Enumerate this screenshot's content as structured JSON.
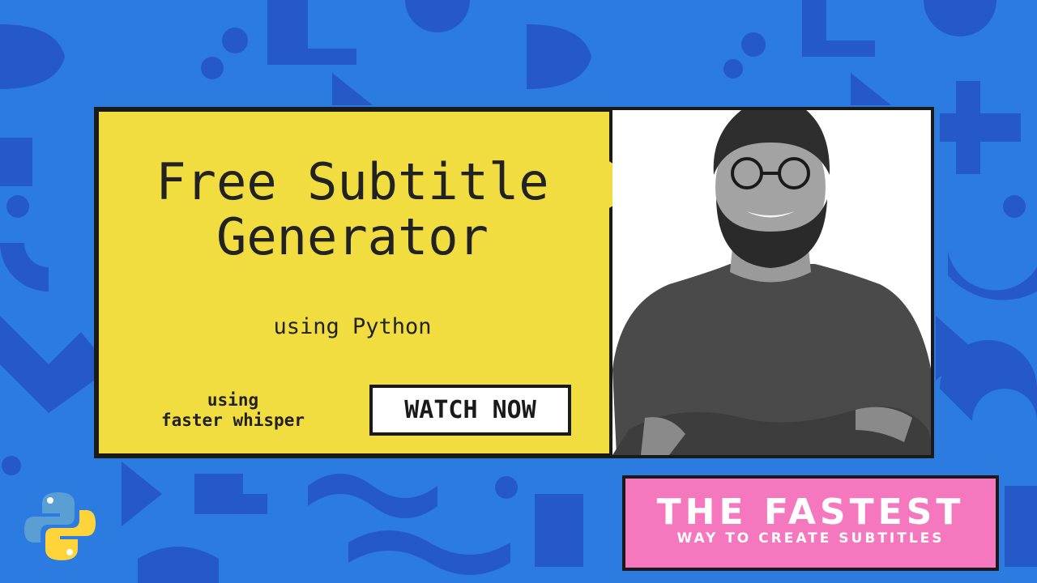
{
  "title_line1": "Free Subtitle",
  "title_line2": "Generator",
  "subtitle": "using Python",
  "side_line1": "using",
  "side_line2": "faster whisper",
  "cta_label": "WATCH NOW",
  "banner_big": "THE FASTEST",
  "banner_small": "WAY TO CREATE SUBTITLES",
  "colors": {
    "background": "#2b7be0",
    "pattern": "#2559c8",
    "yellow": "#f2dd40",
    "pink": "#f577bd",
    "ink": "#1a1a1a"
  }
}
